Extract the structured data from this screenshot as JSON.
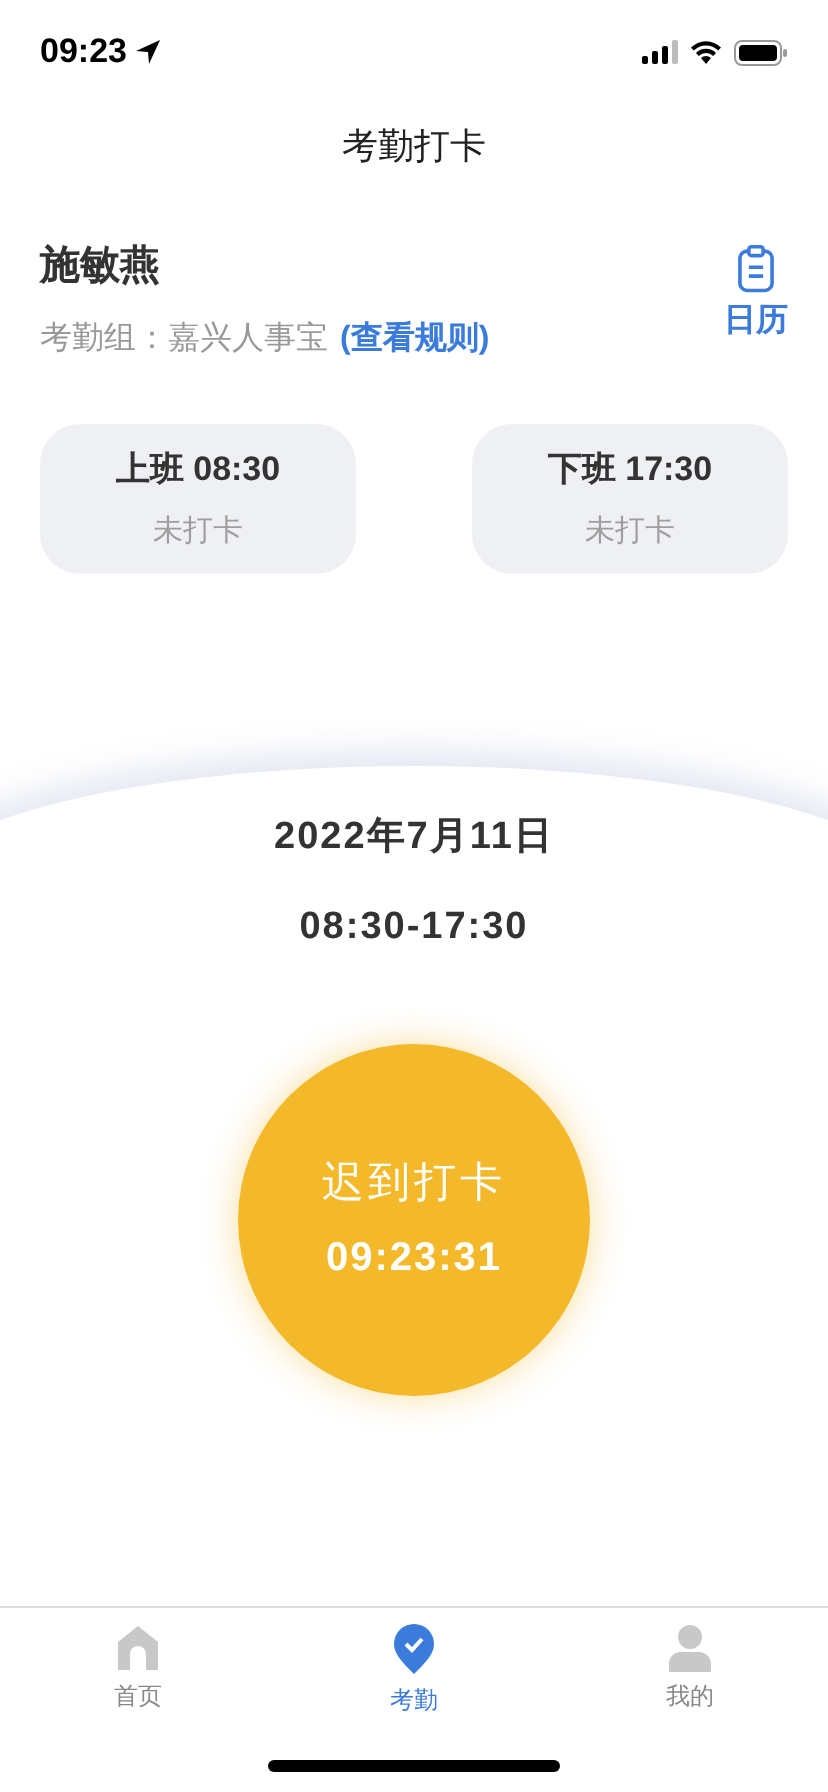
{
  "status_bar": {
    "time": "09:23"
  },
  "nav": {
    "title": "考勤打卡"
  },
  "user": {
    "name": "施敏燕",
    "group_label": "考勤组：嘉兴人事宝",
    "rules_link": "(查看规则)",
    "calendar_label": "日历"
  },
  "shifts": [
    {
      "label": "上班 08:30",
      "status": "未打卡",
      "punched": false
    },
    {
      "label": "下班 17:30",
      "status": "未打卡",
      "punched": false
    }
  ],
  "punch": {
    "date": "2022年7月11日",
    "hours": "08:30-17:30",
    "button_label": "迟到打卡",
    "clock": "09:23:31"
  },
  "tabs": [
    {
      "kind": "home",
      "label": "首页",
      "selected": false
    },
    {
      "kind": "attendance",
      "label": "考勤",
      "selected": true
    },
    {
      "kind": "profile",
      "label": "我的",
      "selected": false
    }
  ]
}
